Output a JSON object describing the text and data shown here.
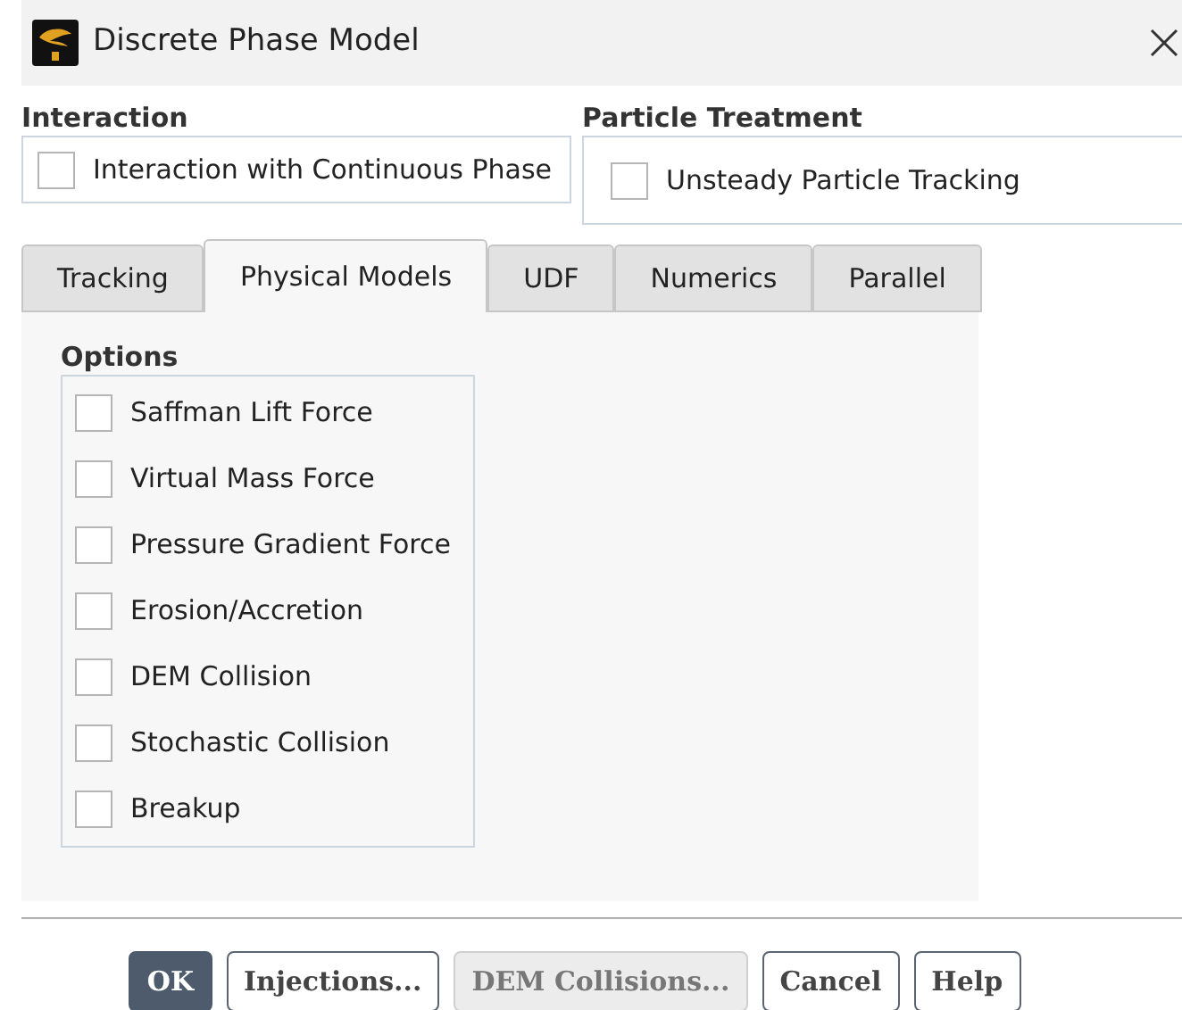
{
  "window": {
    "title": "Discrete Phase Model"
  },
  "interaction": {
    "heading": "Interaction",
    "options": [
      {
        "label": "Interaction with Continuous Phase",
        "checked": false
      }
    ]
  },
  "particle_treatment": {
    "heading": "Particle Treatment",
    "options": [
      {
        "label": "Unsteady Particle Tracking",
        "checked": false
      }
    ]
  },
  "tabs": [
    {
      "label": "Tracking",
      "selected": false
    },
    {
      "label": "Physical Models",
      "selected": true
    },
    {
      "label": "UDF",
      "selected": false
    },
    {
      "label": "Numerics",
      "selected": false
    },
    {
      "label": "Parallel",
      "selected": false
    }
  ],
  "options": {
    "heading": "Options",
    "items": [
      {
        "label": "Saffman Lift Force",
        "checked": false
      },
      {
        "label": "Virtual Mass Force",
        "checked": false
      },
      {
        "label": "Pressure Gradient Force",
        "checked": false
      },
      {
        "label": "Erosion/Accretion",
        "checked": false
      },
      {
        "label": "DEM Collision",
        "checked": false
      },
      {
        "label": "Stochastic Collision",
        "checked": false
      },
      {
        "label": "Breakup",
        "checked": false
      }
    ]
  },
  "buttons": [
    {
      "label": "OK",
      "kind": "primary",
      "disabled": false
    },
    {
      "label": "Injections...",
      "kind": "normal",
      "disabled": false
    },
    {
      "label": "DEM Collisions...",
      "kind": "normal",
      "disabled": true
    },
    {
      "label": "Cancel",
      "kind": "normal",
      "disabled": false
    },
    {
      "label": "Help",
      "kind": "normal",
      "disabled": false
    }
  ]
}
